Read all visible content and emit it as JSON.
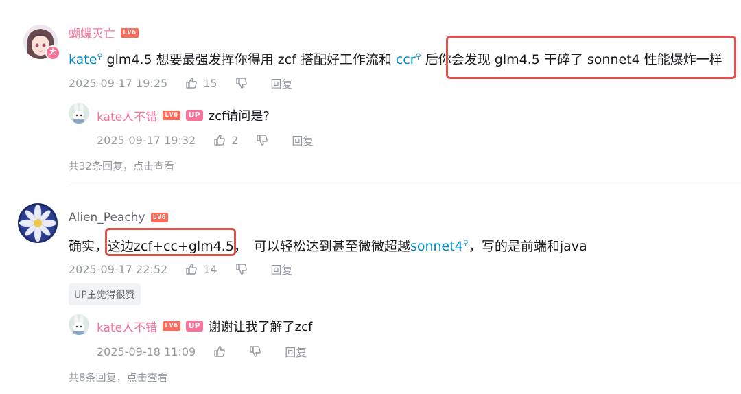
{
  "comments": [
    {
      "username": "蝴蝶灭亡",
      "level": "LV6",
      "avatar_badge": "大",
      "content": {
        "mention1": "kate",
        "text1": " glm4.5 想要最强发挥你得用 zcf 搭配好工作流和 ",
        "mention2": "ccr",
        "text2": " 后",
        "highlight": "你会发现 glm4.5 干碎了 sonnet4 性能爆炸一样"
      },
      "time": "2025-09-17 19:25",
      "likes": "15",
      "reply_label": "回复",
      "replies": [
        {
          "username": "kate人不错",
          "level": "LV6",
          "up_badge": "UP",
          "content": "zcf请问是?",
          "time": "2025-09-17 19:32",
          "likes": "2",
          "reply_label": "回复"
        }
      ],
      "view_more": "共32条回复，点击查看"
    },
    {
      "username": "Alien_Peachy",
      "level": "LV6",
      "content": {
        "prefix": "确实，",
        "highlight": "这边zcf+cc+glm4.5，",
        "text1": "可以轻松达到甚至微微超越",
        "mention": "sonnet4",
        "suffix": "，写的是前端和java"
      },
      "time": "2025-09-17 22:52",
      "likes": "14",
      "reply_label": "回复",
      "tag": "UP主觉得很赞",
      "replies": [
        {
          "username": "kate人不错",
          "level": "LV6",
          "up_badge": "UP",
          "content": "谢谢让我了解了zcf",
          "time": "2025-09-18 11:09",
          "likes": "",
          "reply_label": "回复"
        }
      ],
      "view_more": "共8条回复，点击查看"
    }
  ],
  "colors": {
    "accent_pink": "#fb7299",
    "link_blue": "#008ac5",
    "highlight_red": "#e0524d",
    "meta_gray": "#9499a0"
  }
}
